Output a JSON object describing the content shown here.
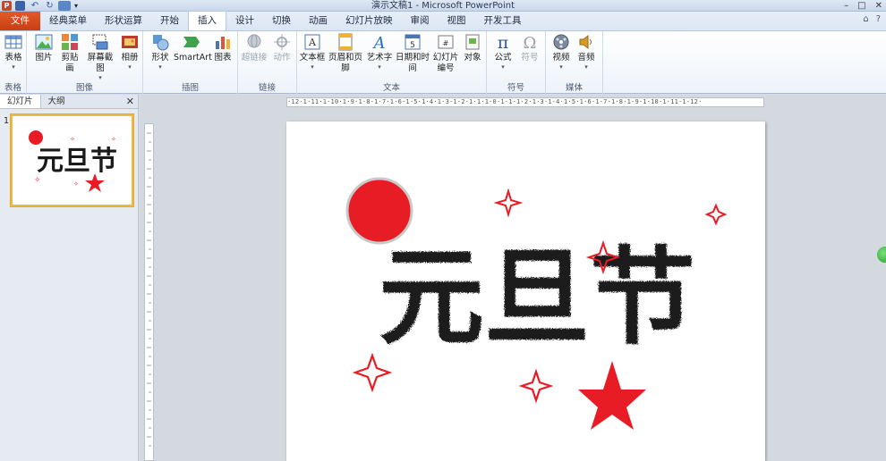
{
  "window": {
    "title": "演示文稿1 - Microsoft PowerPoint",
    "controls": {
      "minimize": "–",
      "maximize": "□",
      "close": "✕"
    }
  },
  "qat": {
    "app_icon_letter": "P"
  },
  "tabs": [
    {
      "label": "文件",
      "key": "file"
    },
    {
      "label": "经典菜单",
      "key": "classic"
    },
    {
      "label": "形状运算",
      "key": "shapes-op"
    },
    {
      "label": "开始",
      "key": "home"
    },
    {
      "label": "插入",
      "key": "insert",
      "active": true
    },
    {
      "label": "设计",
      "key": "design"
    },
    {
      "label": "切换",
      "key": "transitions"
    },
    {
      "label": "动画",
      "key": "animations"
    },
    {
      "label": "幻灯片放映",
      "key": "slideshow"
    },
    {
      "label": "审阅",
      "key": "review"
    },
    {
      "label": "视图",
      "key": "view"
    },
    {
      "label": "开发工具",
      "key": "developer"
    }
  ],
  "ribbon": {
    "groups": [
      {
        "label": "表格",
        "buttons": [
          {
            "label": "表格",
            "icon": "table-icon"
          }
        ]
      },
      {
        "label": "图像",
        "buttons": [
          {
            "label": "图片",
            "icon": "picture-icon"
          },
          {
            "label": "剪贴画",
            "icon": "clipart-icon"
          },
          {
            "label": "屏幕截图",
            "icon": "screenshot-icon"
          },
          {
            "label": "相册",
            "icon": "album-icon"
          }
        ]
      },
      {
        "label": "插图",
        "buttons": [
          {
            "label": "形状",
            "icon": "shapes-icon"
          },
          {
            "label": "SmartArt",
            "icon": "smartart-icon"
          },
          {
            "label": "图表",
            "icon": "chart-icon"
          }
        ]
      },
      {
        "label": "链接",
        "buttons": [
          {
            "label": "超链接",
            "icon": "hyperlink-icon",
            "disabled": true
          },
          {
            "label": "动作",
            "icon": "action-icon",
            "disabled": true
          }
        ]
      },
      {
        "label": "文本",
        "buttons": [
          {
            "label": "文本框",
            "icon": "textbox-icon"
          },
          {
            "label": "页眉和页脚",
            "icon": "header-footer-icon"
          },
          {
            "label": "艺术字",
            "icon": "wordart-icon"
          },
          {
            "label": "日期和时间",
            "icon": "datetime-icon"
          },
          {
            "label": "幻灯片",
            "label2": "编号",
            "icon": "slide-number-icon"
          },
          {
            "label": "对象",
            "icon": "object-icon"
          }
        ]
      },
      {
        "label": "符号",
        "buttons": [
          {
            "label": "公式",
            "icon": "equation-icon"
          },
          {
            "label": "符号",
            "icon": "symbol-icon",
            "disabled": true
          }
        ]
      },
      {
        "label": "媒体",
        "buttons": [
          {
            "label": "视频",
            "icon": "video-icon"
          },
          {
            "label": "音频",
            "icon": "audio-icon"
          }
        ]
      }
    ]
  },
  "left_pane": {
    "tabs": [
      {
        "label": "幻灯片",
        "active": true
      },
      {
        "label": "大纲"
      }
    ],
    "close": "✕",
    "thumbnails": [
      {
        "number": "1",
        "text": "元旦节"
      }
    ]
  },
  "ruler": {
    "h_ticks": "·12·1·11·1·10·1·9·1·8·1·7·1·6·1·5·1·4·1·3·1·2·1·1·1·0·1·1·1·2·1·3·1·4·1·5·1·6·1·7·1·8·1·9·1·10·1·11·1·12·"
  },
  "slide": {
    "title_text": "元旦节",
    "colors": {
      "accent": "#e81c24",
      "text": "#1a1a1a"
    }
  }
}
